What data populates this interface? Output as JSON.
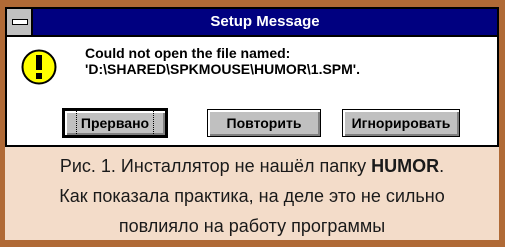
{
  "dialog": {
    "title": "Setup Message",
    "message_line1": "Could not open the file named:",
    "message_line2": "'D:\\SHARED\\SPKMOUSE\\HUMOR\\1.SPM'.",
    "icon": "exclamation-icon",
    "buttons": {
      "abort": "Прервано",
      "retry": "Повторить",
      "ignore": "Игнорировать"
    }
  },
  "caption": {
    "line1_prefix": "Рис. 1. Инсталлятор не нашёл папку ",
    "line1_bold": "HUMOR",
    "line1_suffix": ".",
    "line2": "Как показала практика, на деле это не сильно",
    "line3": "повлияло на работу программы"
  },
  "colors": {
    "frame": "#b06a36",
    "caption_bg": "#f3dcc9",
    "titlebar": "#000080",
    "button_face": "#c0c0c0",
    "icon_yellow": "#ffff00"
  }
}
